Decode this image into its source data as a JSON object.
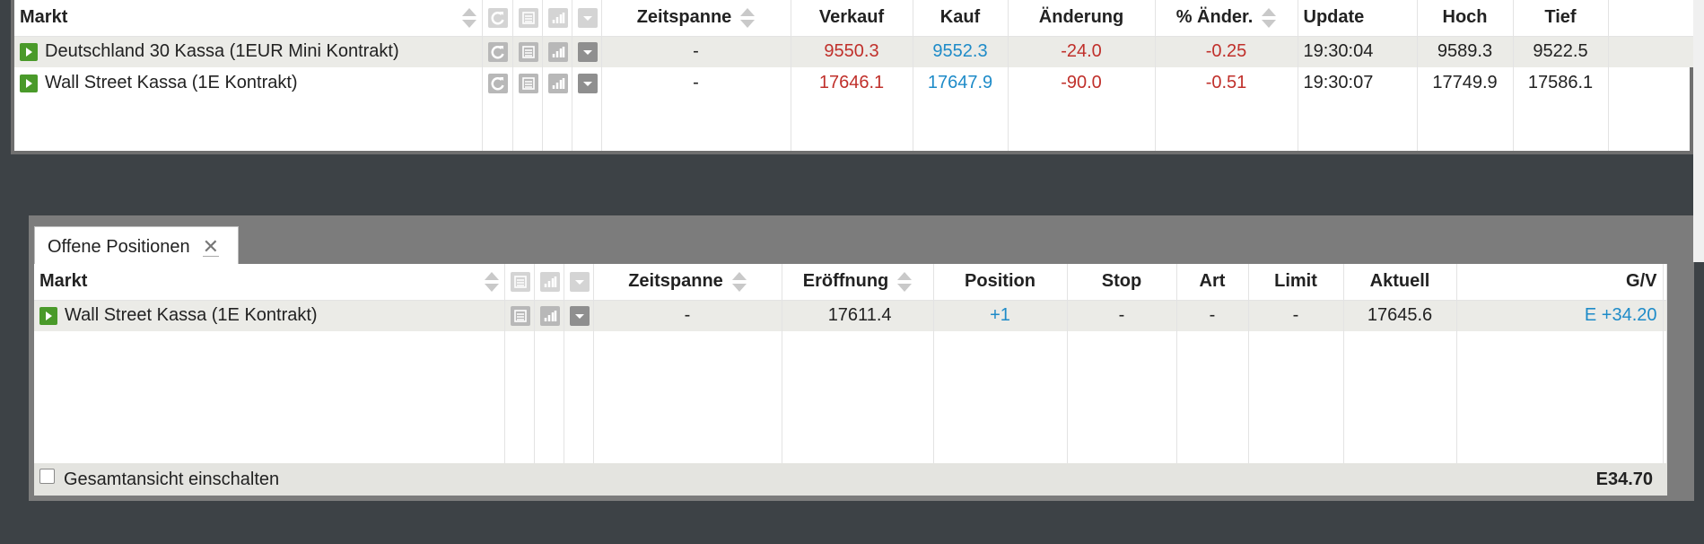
{
  "watchlist": {
    "columns": {
      "market": "Markt",
      "timeframe": "Zeitspanne",
      "sell": "Verkauf",
      "buy": "Kauf",
      "change": "Änderung",
      "pct_change": "% Änder.",
      "update": "Update",
      "high": "Hoch",
      "low": "Tief"
    },
    "rows": [
      {
        "market": "Deutschland 30 Kassa (1EUR Mini Kontrakt)",
        "timeframe": "-",
        "sell": "9550.3",
        "buy": "9552.3",
        "change": "-24.0",
        "pct_change": "-0.25",
        "update": "19:30:04",
        "high": "9589.3",
        "low": "9522.5"
      },
      {
        "market": "Wall Street Kassa (1E Kontrakt)",
        "timeframe": "-",
        "sell": "17646.1",
        "buy": "17647.9",
        "change": "-90.0",
        "pct_change": "-0.51",
        "update": "19:30:07",
        "high": "17749.9",
        "low": "17586.1"
      }
    ]
  },
  "positions": {
    "tab_label": "Offene Positionen",
    "tab_close": "✕",
    "columns": {
      "market": "Markt",
      "timeframe": "Zeitspanne",
      "opening": "Eröffnung",
      "position": "Position",
      "stop": "Stop",
      "type": "Art",
      "limit": "Limit",
      "current": "Aktuell",
      "pnl": "G/V"
    },
    "rows": [
      {
        "market": "Wall Street Kassa (1E Kontrakt)",
        "timeframe": "-",
        "opening": "17611.4",
        "position": "+1",
        "stop": "-",
        "type": "-",
        "limit": "-",
        "current": "17645.6",
        "pnl": "E +34.20"
      }
    ],
    "footer": {
      "overview_label": "Gesamtansicht einschalten",
      "total": "E34.70"
    }
  },
  "colors": {
    "negative": "#c0302b",
    "positive": "#1e8bc8",
    "play_green": "#4a9a2a",
    "background": "#3d4246"
  }
}
